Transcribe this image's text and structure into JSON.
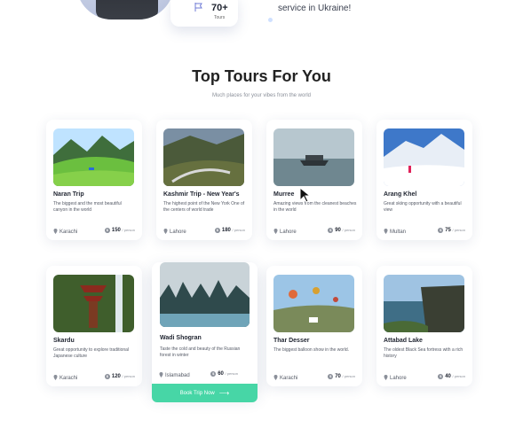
{
  "hero": {
    "tours_count": "70+",
    "tours_label": "Tours",
    "tagline_fragment": "service in Ukraine!"
  },
  "section": {
    "title": "Top Tours For You",
    "subtitle": "Much places for your vibes from the world"
  },
  "per_label": "/ person",
  "tours": [
    {
      "name": "Naran Trip",
      "desc": "The biggest and the most beautiful canyon in the world",
      "location": "Karachi",
      "price": "150"
    },
    {
      "name": "Kashmir Trip - New Year's",
      "desc": "The highest point of the New York One of the centers of world trade",
      "location": "Lahore",
      "price": "180"
    },
    {
      "name": "Murree",
      "desc": "Amazing views from the cleanest beaches in the world",
      "location": "Lahore",
      "price": "90"
    },
    {
      "name": "Arang Khel",
      "desc": "Great skiing opportunity with a beautiful view",
      "location": "Multan",
      "price": "75"
    },
    {
      "name": "Skardu",
      "desc": "Great opportunity to explore traditional Japanese culture",
      "location": "Karachi",
      "price": "120"
    },
    {
      "name": "Wadi Shogran",
      "desc": "Taste the cold and beauty of the Russian forest in winter",
      "location": "Islamabad",
      "price": "60"
    },
    {
      "name": "Thar Desser",
      "desc": "The biggest balloon show in the world.",
      "location": "Karachi",
      "price": "70"
    },
    {
      "name": "Attabad Lake",
      "desc": "The oldest Black Sea fortress with a rich history",
      "location": "Lahore",
      "price": "40"
    }
  ],
  "book_button": "Book Trip Now"
}
